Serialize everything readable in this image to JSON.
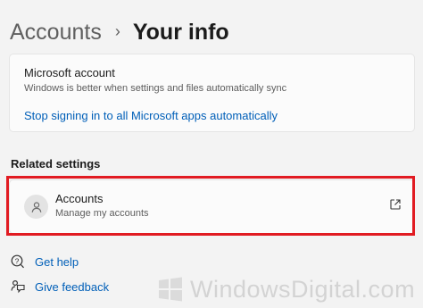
{
  "breadcrumb": {
    "parent": "Accounts",
    "separator": "›",
    "current": "Your info"
  },
  "microsoft_account": {
    "title": "Microsoft account",
    "subtitle": "Windows is better when settings and files automatically sync",
    "link": "Stop signing in to all Microsoft apps automatically"
  },
  "related_settings": {
    "heading": "Related settings",
    "accounts_item": {
      "title": "Accounts",
      "subtitle": "Manage my accounts",
      "avatar_icon": "person-icon",
      "action_icon": "open-external-icon"
    }
  },
  "help": {
    "get_help": "Get help",
    "give_feedback": "Give feedback"
  },
  "watermark": {
    "text": "WindowsDigital.com"
  },
  "colors": {
    "accent_link": "#005fb8",
    "highlight_border": "#e11b22",
    "background": "#f3f3f3",
    "card": "#fbfbfb"
  }
}
